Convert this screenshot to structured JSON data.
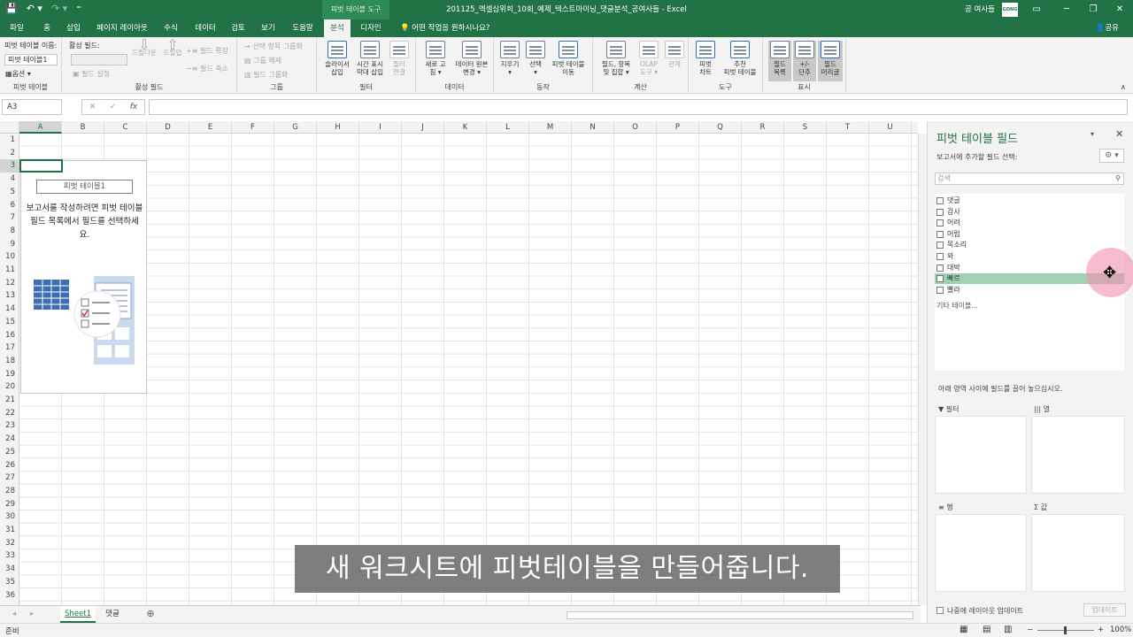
{
  "window": {
    "quick_access": [
      "💾",
      "↶ ▾",
      "↷ ▾",
      "⁼"
    ],
    "contextual_tab": "피벗 테이블 도구",
    "doc_title": "201125_엑셀심위희_10회_예제_텍스트마이닝_댓글분석_공여사들  -  Excel",
    "user_name": "공 여사들",
    "user_badge": "GONG",
    "controls": [
      "▭",
      "─",
      "❐",
      "✕"
    ]
  },
  "tabs": [
    "파일",
    "홈",
    "삽입",
    "페이지 레이아웃",
    "수식",
    "데이터",
    "검토",
    "보기",
    "도움말",
    "분석",
    "디자인"
  ],
  "tell_me": "어떤 작업을 원하시나요?",
  "share": "공유",
  "ribbon": {
    "pivot_name_label": "피벗 테이블 이름:",
    "pivot_name_value": "피벗 테이블1",
    "options": "옵션 ▾",
    "group_pivot": "피벗 테이블",
    "active_field_label": "활성 필드:",
    "field_settings": "필드 설정",
    "drill_down": "드릴다운",
    "drill_up": "드릴업",
    "expand_field": "필드 확장",
    "collapse_field": "필드 축소",
    "group_active": "활성 필드",
    "group_selection": "선택 항목 그룹화",
    "ungroup": "그룹 해제",
    "group_field": "필드 그룹화",
    "group_group": "그룹",
    "slicer": "슬라이서\n삽입",
    "timeline": "시간 표시\n막대 삽입",
    "filter_conn": "필터\n연결",
    "group_filter": "필터",
    "refresh": "새로 고\n침 ▾",
    "change_source": "데이터 원본\n변경 ▾",
    "group_data": "데이터",
    "clear": "지우기\n▾",
    "select": "선택\n▾",
    "move_pivot": "피벗 테이블\n이동",
    "group_actions": "동작",
    "fields_items": "필드, 항목\n및 집합 ▾",
    "olap": "OLAP\n도구 ▾",
    "relationships": "관계",
    "group_calc": "계산",
    "pivot_chart": "피벗\n차트",
    "recommended": "추천\n피벗 테이블",
    "group_tools": "도구",
    "field_list": "필드\n목록",
    "buttons": "+/-\n단추",
    "headers": "필드\n머리글",
    "group_show": "표시"
  },
  "formula_bar": {
    "name_box": "A3",
    "buttons": [
      "✕",
      "✓",
      "fx"
    ]
  },
  "grid": {
    "columns": [
      "A",
      "B",
      "C",
      "D",
      "E",
      "F",
      "G",
      "H",
      "I",
      "J",
      "K",
      "L",
      "M",
      "N",
      "O",
      "P",
      "Q",
      "R",
      "S",
      "T",
      "U"
    ],
    "rows": [
      "1",
      "2",
      "3",
      "4",
      "5",
      "6",
      "7",
      "8",
      "9",
      "10",
      "11",
      "12",
      "13",
      "14",
      "15",
      "16",
      "17",
      "18",
      "19",
      "20",
      "21",
      "22",
      "23",
      "24",
      "25",
      "26",
      "27",
      "28",
      "29",
      "30",
      "31",
      "32",
      "33",
      "34",
      "35",
      "36"
    ],
    "selected_column": "A",
    "selected_row": "3"
  },
  "pivot_placeholder": {
    "name": "피벗 테이블1",
    "message": "보고서를 작성하려면 피벗 테이블 필드 목록에서 필드를 선택하세요."
  },
  "sheets": [
    "Sheet1",
    "댓글"
  ],
  "add_sheet": "⊕",
  "status": {
    "ready": "준비",
    "zoom": "100%"
  },
  "field_pane": {
    "title": "피벗 테이블 필드",
    "subtitle": "보고서에 추가할 필드 선택:",
    "search_placeholder": "검색",
    "fields": [
      "댓글",
      "감사",
      "어려",
      "어럽",
      "목소리",
      "와",
      "대박",
      "빠르",
      "빨라"
    ],
    "hovered_field": "빠르",
    "more_tables": "기타 테이블...",
    "drag_hint": "아래 영역 사이에 필드를 끌어 놓으십시오.",
    "areas": [
      "필터",
      "열",
      "행",
      "값"
    ],
    "area_icons": [
      "▼",
      "|||",
      "≡",
      "Σ"
    ],
    "defer_update": "나중에 레이아웃 업데이트",
    "update_button": "업데이트"
  },
  "subtitle": "새 워크시트에 피벗테이블을 만들어줍니다."
}
